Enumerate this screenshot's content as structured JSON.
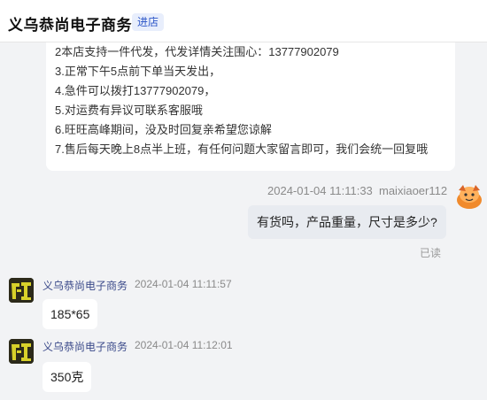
{
  "header": {
    "shop_name": "义乌恭尚电子商务",
    "enter_label": "进店"
  },
  "notice": {
    "lines": [
      "2本店支持一件代发，代发详情关注围心：13777902079",
      "3.正常下午5点前下单当天发出，",
      "4.急件可以拨打13777902079，",
      "5.对运费有异议可联系客服哦",
      "6.旺旺高峰期间，没及时回复亲希望您谅解",
      "7.售后每天晚上8点半上班，有任何问题大家留言即可，我们会统一回复哦"
    ]
  },
  "messages": [
    {
      "sender": "maixiaoer112",
      "time": "2024-01-04 11:11:33",
      "text": "有货吗，产品重量，尺寸是多少?",
      "status": "已读"
    },
    {
      "sender": "义乌恭尚电子商务",
      "time": "2024-01-04 11:11:57",
      "text": "185*65"
    },
    {
      "sender": "义乌恭尚电子商务",
      "time": "2024-01-04 11:12:01",
      "text": "350克"
    }
  ],
  "icons": {
    "user_avatar": "orange-cartoon-avatar-icon",
    "shop_avatar": "shop-logo-icon"
  },
  "colors": {
    "background": "#f2f3f5",
    "enter_button_bg": "#e8eefc",
    "enter_button_text": "#2b55c7",
    "sender_name": "#3b4a8a",
    "my_bubble": "#e8ebf0"
  }
}
